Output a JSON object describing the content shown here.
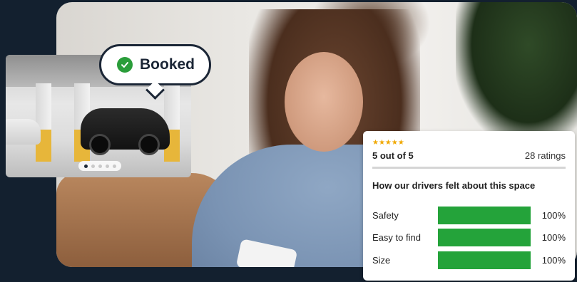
{
  "booked": {
    "label": "Booked",
    "icon": "check-circle-icon",
    "icon_color": "#2a9d3a"
  },
  "carousel": {
    "slides": 5,
    "active": 0
  },
  "ratings": {
    "stars": "★★★★★",
    "score_text": "5 out of 5",
    "count_text": "28 ratings",
    "heading": "How our drivers felt about this space",
    "bar_color": "#24a33a",
    "metrics": [
      {
        "label": "Safety",
        "value": 1.0,
        "value_text": "100%"
      },
      {
        "label": "Easy to find",
        "value": 1.0,
        "value_text": "100%"
      },
      {
        "label": "Size",
        "value": 1.0,
        "value_text": "100%"
      }
    ]
  }
}
